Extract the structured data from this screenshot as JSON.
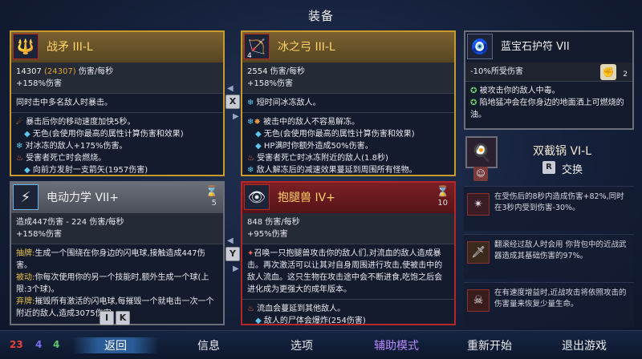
{
  "title": "装备",
  "weapon1": {
    "name": "战矛 III-L",
    "dps": "14307",
    "dps_old": "(24307)",
    "dps_unit": "伤害/每秒",
    "bonus": "+158%伤害",
    "desc": "同时击中多名敌人时暴击。",
    "affixes": [
      "暴击后你的移动速度加快5秒。",
      "无色(会使用你最高的属性计算伤害和效果)",
      "对冰冻的敌人+175%伤害。",
      "受害者死亡时会燃烧。",
      "向前方发射一支箭矢(1957伤害)"
    ]
  },
  "weapon2": {
    "name": "冰之弓 III-L",
    "lvl": "4",
    "dps": "2554",
    "dps_unit": "伤害/每秒",
    "bonus": "+158%伤害",
    "desc": "短时间冰冻敌人。",
    "affixes": [
      "被击中的敌人不容易解冻。",
      "无色(会使用你最高的属性计算伤害和效果)",
      "HP满时你额外造成50%伤害。",
      "受害者死亡时冰冻附近的敌人(1.8秒)",
      "敌人解冻后的减速效果蔓延到周围所有怪物。"
    ]
  },
  "skill1": {
    "name": "电动力学 VII+",
    "cooldown": "5",
    "dps": "造成447伤害 - 224 伤害/每秒",
    "bonus": "+158%伤害",
    "lines": [
      {
        "label": "抽牌:",
        "text": "生成一个围绕在你身边的闪电球,接触造成447伤害。"
      },
      {
        "label": "被动:",
        "text": "你每次使用你的另一个技能时,额外生成一个球(上限:3个球)。"
      },
      {
        "label": "弃牌:",
        "text": "摧毁所有激活的闪电球,每摧毁一个就电击一次一个附近的敌人,造成3075伤害。"
      }
    ]
  },
  "skill2": {
    "name": "抱腿兽 IV+",
    "cooldown": "10",
    "dps": "848 伤害/每秒",
    "bonus": "+95%伤害",
    "desc": "召唤一只抱腿兽攻击你的敌人们,对流血的敌人造成暴击。再次激活可以让其对自身周围进行攻击,使被击中的敌人流血。这只生物在攻击途中会不断进食,吃饱之后会进化成为更强大的成年版本。",
    "affixes": [
      "流血会蔓延到其他敌人。",
      "敌人的尸体会爆炸(254伤害)"
    ]
  },
  "amulet": {
    "name": "蓝宝石护符 VII",
    "stat": "-10%所受伤害",
    "count": "2",
    "affixes": [
      "被攻击你的敌人中毒。",
      "陷地猛冲会在你身边的地面洒上可燃烧的油。"
    ]
  },
  "backpack": {
    "name": "双截锅 VI-L",
    "key": "R",
    "action": "交换"
  },
  "mutations": [
    "在受伤后的8秒内造成伤害+82%,同时在3秒内受到伤害-30%。",
    "翻滚经过敌人时会用 你背包中的近战武器造成其基础伤害的97%。",
    "在有速度增益时,近战攻击将依照攻击的伤害量来恢复少量生命。"
  ],
  "swap_keys": {
    "x": "X",
    "y": "Y",
    "i": "I",
    "k": "K"
  },
  "stats": {
    "brutality": "23",
    "tactics": "4",
    "survival": "4"
  },
  "nav": {
    "back": "返回",
    "info": "信息",
    "options": "选项",
    "assist": "辅助模式",
    "restart": "重新开始",
    "quit": "退出游戏"
  },
  "colors": {
    "gold_border": "#c89a2a",
    "red_border": "#b52626",
    "brutality": "#e8413c",
    "tactics": "#7b6cf2",
    "survival": "#5cc86b",
    "assist": "#b989ff"
  }
}
